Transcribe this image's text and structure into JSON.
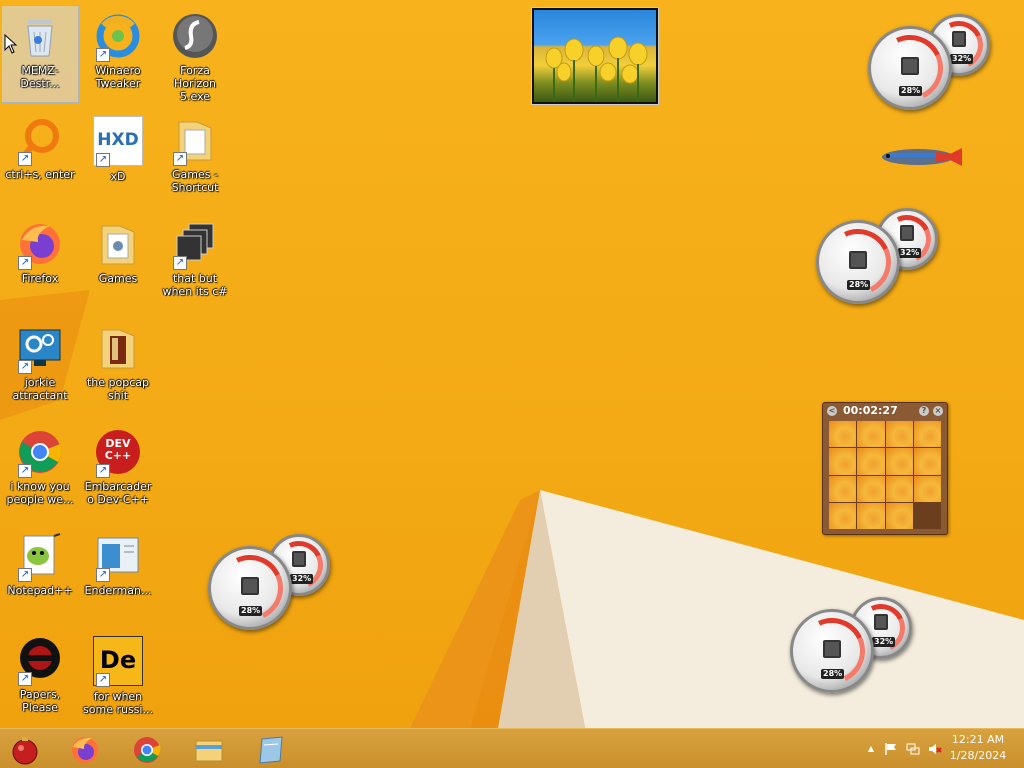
{
  "desktop": {
    "icons": [
      {
        "label": "MEMZ-Destr..."
      },
      {
        "label": "Winaero Tweaker"
      },
      {
        "label": "Forza Horizon 5.exe"
      },
      {
        "label": "ctrl+s, enter"
      },
      {
        "label": "xD"
      },
      {
        "label": "Games - Shortcut"
      },
      {
        "label": "Firefox"
      },
      {
        "label": "Games"
      },
      {
        "label": "that but when its c#"
      },
      {
        "label": "jorkie attractant"
      },
      {
        "label": "the popcap shit"
      },
      {
        "label": "i know you people we..."
      },
      {
        "label": "Embarcadero Dev-C++"
      },
      {
        "label": "Notepad++"
      },
      {
        "label": "Enderman..."
      },
      {
        "label": "Papers, Please"
      },
      {
        "label": "for when some russi..."
      }
    ],
    "icon_glyphs": {
      "hxd": "HXD",
      "devcpp": "DEV C++",
      "de": "De"
    },
    "gadgets": {
      "cpu_meter": {
        "cpu_percent": "28%",
        "memory_percent": "32%"
      },
      "puzzle": {
        "timer": "00:02:27",
        "help_button": "?",
        "close_button": "×",
        "back_button": "<"
      }
    }
  },
  "taskbar": {
    "clock_time": "12:21 AM",
    "clock_date": "1/28/2024",
    "tray_expand": "▲"
  },
  "colors": {
    "desktop_bg": "#f3aa14",
    "taskbar_bg": "#c98f2c",
    "meter_red": "#e23a2a"
  }
}
